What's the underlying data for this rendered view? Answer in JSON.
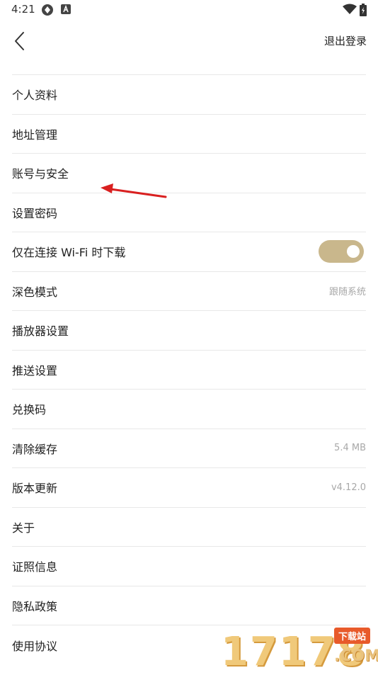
{
  "status_bar": {
    "time": "4:21",
    "icons": [
      "sync-icon",
      "a-badge-icon",
      "wifi-icon",
      "battery-icon"
    ]
  },
  "header": {
    "back_icon": "chevron-left-icon",
    "logout_label": "退出登录"
  },
  "settings": {
    "items": [
      {
        "label": "个人资料",
        "value": ""
      },
      {
        "label": "地址管理",
        "value": ""
      },
      {
        "label": "账号与安全",
        "value": ""
      },
      {
        "label": "设置密码",
        "value": ""
      },
      {
        "label": "仅在连接 Wi-Fi 时下载",
        "value": "",
        "toggle": true
      },
      {
        "label": "深色模式",
        "value": "跟随系统"
      },
      {
        "label": "播放器设置",
        "value": ""
      },
      {
        "label": "推送设置",
        "value": ""
      },
      {
        "label": "兑换码",
        "value": ""
      },
      {
        "label": "清除缓存",
        "value": "5.4 MB"
      },
      {
        "label": "版本更新",
        "value": "v4.12.0"
      },
      {
        "label": "关于",
        "value": ""
      },
      {
        "label": "证照信息",
        "value": ""
      },
      {
        "label": "隐私政策",
        "value": ""
      },
      {
        "label": "使用协议",
        "value": ""
      }
    ]
  },
  "wifi_toggle_on": true,
  "watermark": {
    "number": "17178",
    "badge": "下载站",
    "com": ".COM"
  },
  "colors": {
    "toggle_on": "#c9b78c",
    "annotation_arrow": "#d92020",
    "divider": "#e8e8e8",
    "secondary_text": "#a8a8a8"
  }
}
